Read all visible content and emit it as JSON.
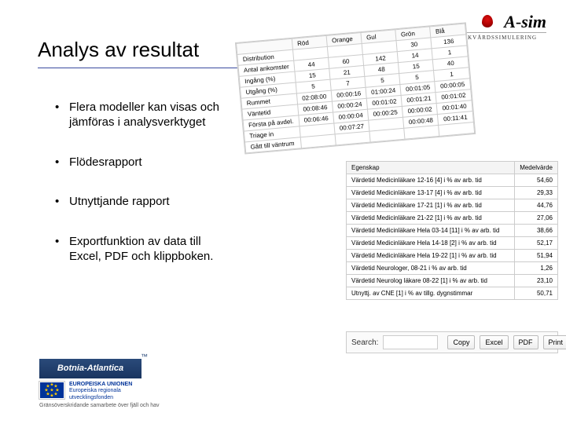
{
  "logo": {
    "brand_a": "A",
    "brand_dash": "-",
    "brand_sim": "sim",
    "sub": "AKUTSJUKVÅRDSSIMULERING"
  },
  "title": "Analys av resultat",
  "bullets": [
    "Flera modeller kan visas och jämföras i analysverktyget",
    "Flödesrapport",
    "Utnyttjande rapport",
    "Exportfunktion av data till Excel, PDF och klippboken."
  ],
  "flow_table": {
    "col_headers": [
      "",
      "Röd",
      "Orange",
      "Gul",
      "Grön",
      "Blå"
    ],
    "rows": [
      {
        "label": "Distribution",
        "v": [
          "",
          "",
          "",
          "30",
          "136"
        ]
      },
      {
        "label": "Antal ankomster",
        "v": [
          "44",
          "60",
          "142",
          "14",
          "1"
        ]
      },
      {
        "label": "Ingång (%)",
        "v": [
          "15",
          "21",
          "48",
          "15",
          "40"
        ]
      },
      {
        "label": "Utgång (%)",
        "v": [
          "5",
          "7",
          "5",
          "5",
          "1"
        ]
      },
      {
        "label": "Rummet",
        "v": [
          "02:08:00",
          "00:00:16",
          "01:00:24",
          "00:01:05",
          "00:00:05"
        ]
      },
      {
        "label": "Väntetid",
        "v": [
          "00:08:46",
          "00:00:24",
          "00:01:02",
          "00:01:21",
          "00:01:02"
        ]
      },
      {
        "label": "Första på avdel.",
        "v": [
          "00:06:46",
          "00:00:04",
          "00:00:25",
          "00:00:02",
          "00:01:40"
        ]
      },
      {
        "label": "Triage in",
        "v": [
          "",
          "00:07:27",
          "",
          "00:00:48",
          "00:11:41"
        ]
      },
      {
        "label": "Gått till väntrum",
        "v": [
          "",
          "",
          "",
          "",
          ""
        ]
      }
    ]
  },
  "util_table": {
    "col_headers": [
      "Egenskap",
      "Medelvärde"
    ],
    "rows": [
      {
        "label": "Värdetid Medicinläkare 12-16 [4] i % av arb. tid",
        "v": "54,60"
      },
      {
        "label": "Värdetid Medicinläkare 13-17 [4] i % av arb. tid",
        "v": "29,33"
      },
      {
        "label": "Värdetid Medicinläkare 17-21 [1] i % av arb. tid",
        "v": "44,76"
      },
      {
        "label": "Värdetid Medicinläkare 21-22 [1] i % av arb. tid",
        "v": "27,06"
      },
      {
        "label": "Värdetid Medicinläkare Hela 03-14 [11] i % av arb. tid",
        "v": "38,66"
      },
      {
        "label": "Värdetid Medicinläkare Hela 14-18 [2] i % av arb. tid",
        "v": "52,17"
      },
      {
        "label": "Värdetid Medicinläkare Hela 19-22 [1] i % av arb. tid",
        "v": "51,94"
      },
      {
        "label": "Värdetid Neurologer, 08-21 i % av arb. tid",
        "v": "1,26"
      },
      {
        "label": "Värdetid Neurolog läkare 08-22 [1] i % av arb. tid",
        "v": "23,10"
      },
      {
        "label": "Utnyttj. av CNE [1] i % av tillg. dygnstimmar",
        "v": "50,71"
      }
    ]
  },
  "toolbar": {
    "search_label": "Search:",
    "btn_copy": "Copy",
    "btn_excel": "Excel",
    "btn_pdf": "PDF",
    "btn_print": "Print"
  },
  "sponsors": {
    "botnia": "Botnia-Atlantica",
    "eu_line1": "EUROPEISKA UNIONEN",
    "eu_line2": "Europeiska regionala",
    "eu_line3": "utvecklingsfonden",
    "footer": "Gränsöverskridande samarbete över fjäll och hav"
  }
}
